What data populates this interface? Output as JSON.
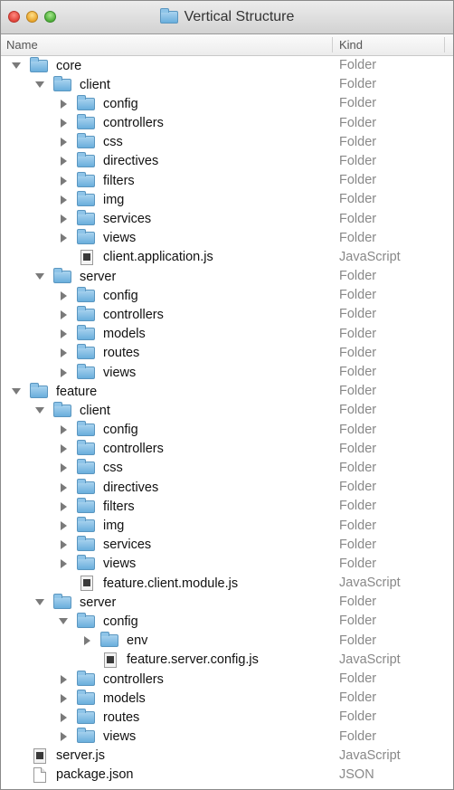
{
  "window": {
    "title": "Vertical Structure",
    "columns": {
      "name": "Name",
      "kind": "Kind"
    }
  },
  "tree": [
    {
      "name": "core",
      "kind": "Folder",
      "level": 0,
      "type": "folder",
      "expanded": true
    },
    {
      "name": "client",
      "kind": "Folder",
      "level": 1,
      "type": "folder",
      "expanded": true
    },
    {
      "name": "config",
      "kind": "Folder",
      "level": 2,
      "type": "folder",
      "expanded": false
    },
    {
      "name": "controllers",
      "kind": "Folder",
      "level": 2,
      "type": "folder",
      "expanded": false
    },
    {
      "name": "css",
      "kind": "Folder",
      "level": 2,
      "type": "folder",
      "expanded": false
    },
    {
      "name": "directives",
      "kind": "Folder",
      "level": 2,
      "type": "folder",
      "expanded": false
    },
    {
      "name": "filters",
      "kind": "Folder",
      "level": 2,
      "type": "folder",
      "expanded": false
    },
    {
      "name": "img",
      "kind": "Folder",
      "level": 2,
      "type": "folder",
      "expanded": false
    },
    {
      "name": "services",
      "kind": "Folder",
      "level": 2,
      "type": "folder",
      "expanded": false
    },
    {
      "name": "views",
      "kind": "Folder",
      "level": 2,
      "type": "folder",
      "expanded": false
    },
    {
      "name": "client.application.js",
      "kind": "JavaScript",
      "level": 2,
      "type": "js"
    },
    {
      "name": "server",
      "kind": "Folder",
      "level": 1,
      "type": "folder",
      "expanded": true
    },
    {
      "name": "config",
      "kind": "Folder",
      "level": 2,
      "type": "folder",
      "expanded": false
    },
    {
      "name": "controllers",
      "kind": "Folder",
      "level": 2,
      "type": "folder",
      "expanded": false
    },
    {
      "name": "models",
      "kind": "Folder",
      "level": 2,
      "type": "folder",
      "expanded": false
    },
    {
      "name": "routes",
      "kind": "Folder",
      "level": 2,
      "type": "folder",
      "expanded": false
    },
    {
      "name": "views",
      "kind": "Folder",
      "level": 2,
      "type": "folder",
      "expanded": false
    },
    {
      "name": "feature",
      "kind": "Folder",
      "level": 0,
      "type": "folder",
      "expanded": true
    },
    {
      "name": "client",
      "kind": "Folder",
      "level": 1,
      "type": "folder",
      "expanded": true
    },
    {
      "name": "config",
      "kind": "Folder",
      "level": 2,
      "type": "folder",
      "expanded": false
    },
    {
      "name": "controllers",
      "kind": "Folder",
      "level": 2,
      "type": "folder",
      "expanded": false
    },
    {
      "name": "css",
      "kind": "Folder",
      "level": 2,
      "type": "folder",
      "expanded": false
    },
    {
      "name": "directives",
      "kind": "Folder",
      "level": 2,
      "type": "folder",
      "expanded": false
    },
    {
      "name": "filters",
      "kind": "Folder",
      "level": 2,
      "type": "folder",
      "expanded": false
    },
    {
      "name": "img",
      "kind": "Folder",
      "level": 2,
      "type": "folder",
      "expanded": false
    },
    {
      "name": "services",
      "kind": "Folder",
      "level": 2,
      "type": "folder",
      "expanded": false
    },
    {
      "name": "views",
      "kind": "Folder",
      "level": 2,
      "type": "folder",
      "expanded": false
    },
    {
      "name": "feature.client.module.js",
      "kind": "JavaScript",
      "level": 2,
      "type": "js"
    },
    {
      "name": "server",
      "kind": "Folder",
      "level": 1,
      "type": "folder",
      "expanded": true
    },
    {
      "name": "config",
      "kind": "Folder",
      "level": 2,
      "type": "folder",
      "expanded": true
    },
    {
      "name": "env",
      "kind": "Folder",
      "level": 3,
      "type": "folder",
      "expanded": false
    },
    {
      "name": "feature.server.config.js",
      "kind": "JavaScript",
      "level": 3,
      "type": "js"
    },
    {
      "name": "controllers",
      "kind": "Folder",
      "level": 2,
      "type": "folder",
      "expanded": false
    },
    {
      "name": "models",
      "kind": "Folder",
      "level": 2,
      "type": "folder",
      "expanded": false
    },
    {
      "name": "routes",
      "kind": "Folder",
      "level": 2,
      "type": "folder",
      "expanded": false
    },
    {
      "name": "views",
      "kind": "Folder",
      "level": 2,
      "type": "folder",
      "expanded": false
    },
    {
      "name": "server.js",
      "kind": "JavaScript",
      "level": 0,
      "type": "js"
    },
    {
      "name": "package.json",
      "kind": "JSON",
      "level": 0,
      "type": "doc"
    }
  ]
}
